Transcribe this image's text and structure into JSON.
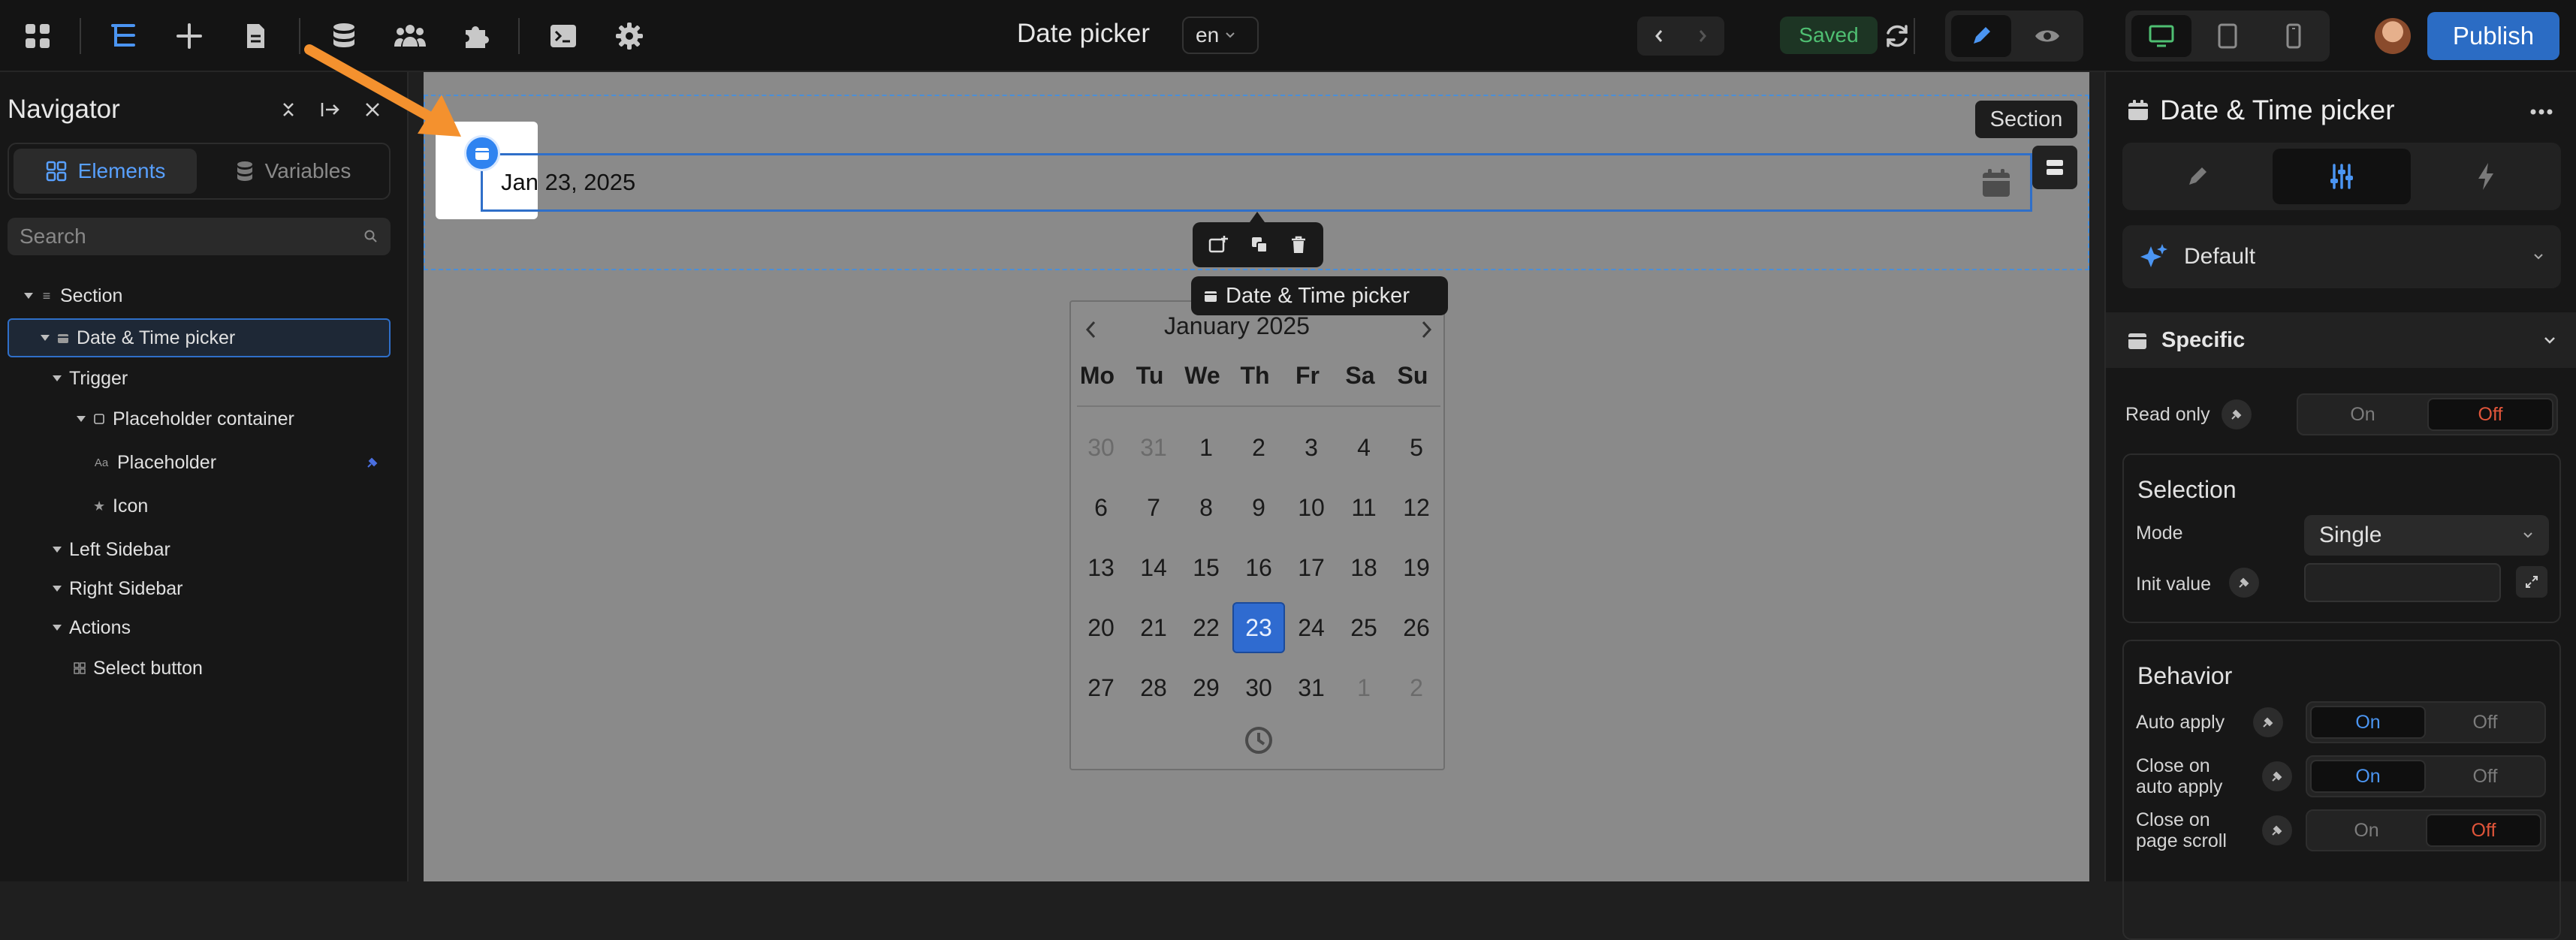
{
  "topbar": {
    "page_title": "Date picker",
    "language": "en",
    "save_status": "Saved",
    "publish_label": "Publish"
  },
  "navigator": {
    "title": "Navigator",
    "tabs": [
      "Elements",
      "Variables"
    ],
    "search_placeholder": "Search",
    "tree": [
      {
        "label": "Section",
        "icon": "section-icon"
      },
      {
        "label": "Date & Time picker",
        "icon": "calendar-icon"
      },
      {
        "label": "Trigger",
        "icon": "none"
      },
      {
        "label": "Placeholder container",
        "icon": "box-icon"
      },
      {
        "label": "Placeholder",
        "icon": "text-icon",
        "glyph": "Aa"
      },
      {
        "label": "Icon",
        "icon": "star-icon"
      },
      {
        "label": "Left Sidebar",
        "icon": "none"
      },
      {
        "label": "Right Sidebar",
        "icon": "none"
      },
      {
        "label": "Actions",
        "icon": "none"
      },
      {
        "label": "Select button",
        "icon": "grid-icon"
      }
    ]
  },
  "canvas": {
    "section_label": "Section",
    "date_value": "Jan 23, 2025",
    "element_label": "Date & Time picker",
    "calendar": {
      "month_label": "January 2025",
      "weekdays": [
        "Mo",
        "Tu",
        "We",
        "Th",
        "Fr",
        "Sa",
        "Su"
      ],
      "weeks": [
        [
          "30",
          "31",
          "1",
          "2",
          "3",
          "4",
          "5"
        ],
        [
          "6",
          "7",
          "8",
          "9",
          "10",
          "11",
          "12"
        ],
        [
          "13",
          "14",
          "15",
          "16",
          "17",
          "18",
          "19"
        ],
        [
          "20",
          "21",
          "22",
          "23",
          "24",
          "25",
          "26"
        ],
        [
          "27",
          "28",
          "29",
          "30",
          "31",
          "1",
          "2"
        ]
      ],
      "selected_day": "23"
    }
  },
  "properties": {
    "title": "Date & Time picker",
    "preset": "Default",
    "section_title": "Specific",
    "read_only": {
      "label": "Read only",
      "on": "On",
      "off": "Off",
      "value": "Off"
    },
    "selection": {
      "title": "Selection",
      "mode_label": "Mode",
      "mode_value": "Single",
      "init_label": "Init value"
    },
    "behavior": {
      "title": "Behavior",
      "auto_apply": {
        "label": "Auto apply",
        "on": "On",
        "off": "Off",
        "value": "On"
      },
      "close_on_auto_apply": {
        "label_line1": "Close on",
        "label_line2": "auto apply",
        "on": "On",
        "off": "Off",
        "value": "On"
      },
      "close_on_page_scroll": {
        "label_line1": "Close on",
        "label_line2": "page scroll",
        "on": "On",
        "off": "Off",
        "value": "Off"
      }
    }
  },
  "colors": {
    "accent_blue": "#2f6fc9",
    "publish": "#2b6cc4",
    "saved_green": "#4fbf72",
    "off_red": "#e0553a",
    "arrow_orange": "#f4912e"
  }
}
